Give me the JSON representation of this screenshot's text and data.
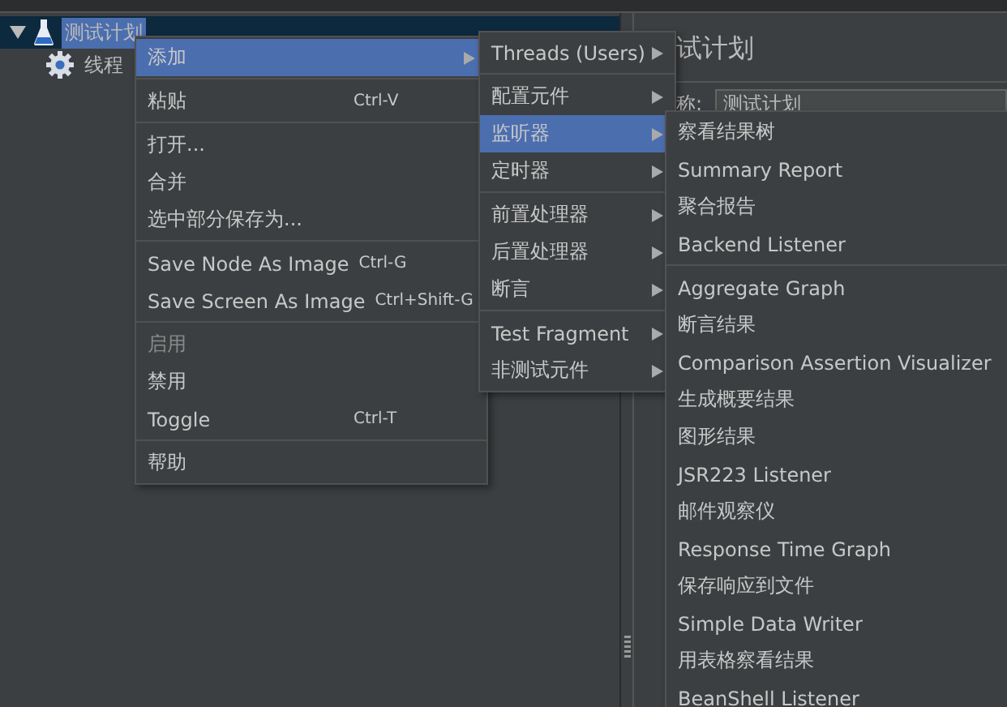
{
  "tree": [
    {
      "label": "测试计划",
      "selected": true,
      "expanded": true,
      "children": [
        {
          "label": "线程",
          "selected": false
        }
      ]
    }
  ],
  "panel": {
    "title": "试计划",
    "name_label": "称:",
    "name_value": "测试计划"
  },
  "menus": [
    {
      "groups": [
        [
          {
            "label": "添加",
            "submenu": true,
            "selected": true,
            "disabled": false
          }
        ],
        [
          {
            "label": "粘贴",
            "shortcut": "Ctrl-V",
            "submenu": false,
            "selected": false,
            "disabled": false
          }
        ],
        [
          {
            "label": "打开...",
            "submenu": false,
            "selected": false,
            "disabled": false
          },
          {
            "label": "合并",
            "submenu": false,
            "selected": false,
            "disabled": false
          },
          {
            "label": "选中部分保存为...",
            "submenu": false,
            "selected": false,
            "disabled": false
          }
        ],
        [
          {
            "label": "Save Node As Image",
            "shortcut": "Ctrl-G",
            "submenu": false,
            "selected": false,
            "disabled": false
          },
          {
            "label": "Save Screen As Image",
            "shortcut": "Ctrl+Shift-G",
            "submenu": false,
            "selected": false,
            "disabled": false
          }
        ],
        [
          {
            "label": "启用",
            "submenu": false,
            "selected": false,
            "disabled": true
          },
          {
            "label": "禁用",
            "submenu": false,
            "selected": false,
            "disabled": false
          },
          {
            "label": "Toggle",
            "shortcut": "Ctrl-T",
            "submenu": false,
            "selected": false,
            "disabled": false
          }
        ],
        [
          {
            "label": "帮助",
            "submenu": false,
            "selected": false,
            "disabled": false
          }
        ]
      ]
    },
    {
      "groups": [
        [
          {
            "label": "Threads (Users)",
            "submenu": true,
            "selected": false,
            "disabled": false
          }
        ],
        [
          {
            "label": "配置元件",
            "submenu": true,
            "selected": false,
            "disabled": false
          },
          {
            "label": "监听器",
            "submenu": true,
            "selected": true,
            "disabled": false
          },
          {
            "label": "定时器",
            "submenu": true,
            "selected": false,
            "disabled": false
          }
        ],
        [
          {
            "label": "前置处理器",
            "submenu": true,
            "selected": false,
            "disabled": false
          },
          {
            "label": "后置处理器",
            "submenu": true,
            "selected": false,
            "disabled": false
          },
          {
            "label": "断言",
            "submenu": true,
            "selected": false,
            "disabled": false
          }
        ],
        [
          {
            "label": "Test Fragment",
            "submenu": true,
            "selected": false,
            "disabled": false
          },
          {
            "label": "非测试元件",
            "submenu": true,
            "selected": false,
            "disabled": false
          }
        ]
      ]
    },
    {
      "groups": [
        [
          {
            "label": "察看结果树",
            "submenu": false,
            "selected": false,
            "disabled": false
          },
          {
            "label": "Summary Report",
            "submenu": false,
            "selected": false,
            "disabled": false
          },
          {
            "label": "聚合报告",
            "submenu": false,
            "selected": false,
            "disabled": false
          },
          {
            "label": "Backend Listener",
            "submenu": false,
            "selected": false,
            "disabled": false
          }
        ],
        [
          {
            "label": "Aggregate Graph",
            "submenu": false,
            "selected": false,
            "disabled": false
          },
          {
            "label": "断言结果",
            "submenu": false,
            "selected": false,
            "disabled": false
          },
          {
            "label": "Comparison Assertion Visualizer",
            "submenu": false,
            "selected": false,
            "disabled": false
          },
          {
            "label": "生成概要结果",
            "submenu": false,
            "selected": false,
            "disabled": false
          },
          {
            "label": "图形结果",
            "submenu": false,
            "selected": false,
            "disabled": false
          },
          {
            "label": "JSR223 Listener",
            "submenu": false,
            "selected": false,
            "disabled": false
          },
          {
            "label": "邮件观察仪",
            "submenu": false,
            "selected": false,
            "disabled": false
          },
          {
            "label": "Response Time Graph",
            "submenu": false,
            "selected": false,
            "disabled": false
          },
          {
            "label": "保存响应到文件",
            "submenu": false,
            "selected": false,
            "disabled": false
          },
          {
            "label": "Simple Data Writer",
            "submenu": false,
            "selected": false,
            "disabled": false
          },
          {
            "label": "用表格察看结果",
            "submenu": false,
            "selected": false,
            "disabled": false
          },
          {
            "label": "BeanShell Listener",
            "submenu": false,
            "selected": false,
            "disabled": false
          }
        ]
      ]
    }
  ]
}
